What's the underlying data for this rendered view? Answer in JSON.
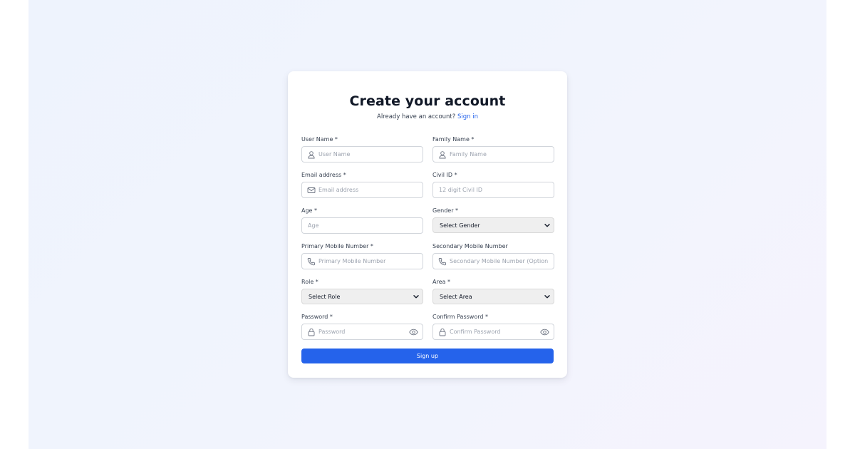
{
  "header": {
    "title": "Create your account",
    "subtitle_text": "Already have an account?",
    "signin_link": "Sign in"
  },
  "fields": {
    "user_name": {
      "label": "User Name *",
      "placeholder": "User Name",
      "icon": "user-icon"
    },
    "family_name": {
      "label": "Family Name *",
      "placeholder": "Family Name",
      "icon": "user-icon"
    },
    "email": {
      "label": "Email address *",
      "placeholder": "Email address",
      "icon": "mail-icon"
    },
    "civil_id": {
      "label": "Civil ID *",
      "placeholder": "12 digit Civil ID"
    },
    "age": {
      "label": "Age *",
      "placeholder": "Age"
    },
    "gender": {
      "label": "Gender *",
      "selected": "Select Gender"
    },
    "primary_mobile": {
      "label": "Primary Mobile Number *",
      "placeholder": "Primary Mobile Number",
      "icon": "phone-icon"
    },
    "secondary_mobile": {
      "label": "Secondary Mobile Number",
      "placeholder": "Secondary Mobile Number (Optional)",
      "icon": "phone-icon"
    },
    "role": {
      "label": "Role *",
      "selected": "Select Role"
    },
    "area": {
      "label": "Area *",
      "selected": "Select Area"
    },
    "password": {
      "label": "Password *",
      "placeholder": "Password",
      "icon": "lock-icon",
      "toggle_icon": "eye-icon"
    },
    "confirm_password": {
      "label": "Confirm Password *",
      "placeholder": "Confirm Password",
      "icon": "lock-icon",
      "toggle_icon": "eye-icon"
    }
  },
  "submit_label": "Sign up",
  "colors": {
    "accent": "#2563eb",
    "title": "#111827",
    "label": "#374151",
    "placeholder": "#9ca3af",
    "border": "#d1d5db",
    "page_background": "#eef3fd",
    "card_background": "#ffffff",
    "select_background": "#efefef"
  }
}
